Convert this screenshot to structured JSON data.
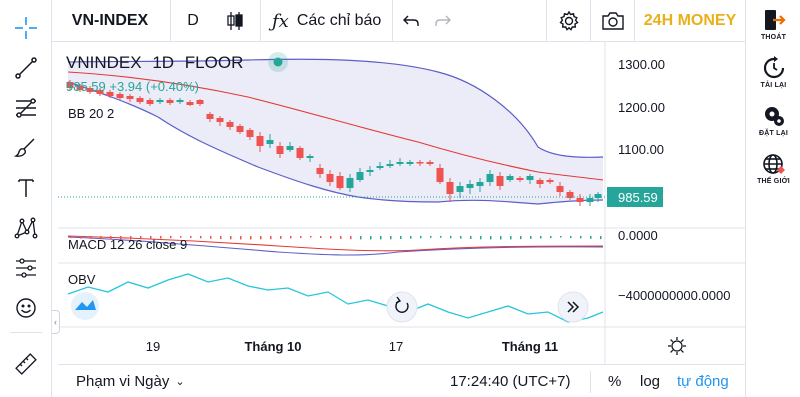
{
  "toolbar": {
    "symbol": "VN-INDEX",
    "interval": "D",
    "indicators_label": "Các chỉ báo",
    "brand": "24H MONEY"
  },
  "legend": {
    "title": "VNINDEX",
    "interval": "1D",
    "exchange": "FLOOR",
    "price_line": "985.59 +3.94 (+0.40%)",
    "bb": "BB 20 2",
    "macd": "MACD 12 26 close 9",
    "obv": "OBV"
  },
  "price_axis": {
    "ticks": [
      "1300.00",
      "1200.00",
      "1100.00"
    ],
    "last_price": "985.59",
    "macd_tick": "0.0000",
    "obv_tick": "−4000000000.0000"
  },
  "time_axis": {
    "ticks": [
      "19",
      "Tháng 10",
      "17",
      "Tháng 11"
    ]
  },
  "bottom": {
    "range_label": "Phạm vi Ngày",
    "clock": "17:24:40 (UTC+7)",
    "percent": "%",
    "log": "log",
    "auto": "tự động"
  },
  "sidebar": {
    "items": [
      {
        "label": "THOÁT",
        "icon": "logout-icon"
      },
      {
        "label": "TẢI LẠI",
        "icon": "reload-icon"
      },
      {
        "label": "ĐẶT LẠI",
        "icon": "reset-gear-icon"
      },
      {
        "label": "THẾ GIỚI",
        "icon": "globe-icon"
      }
    ]
  },
  "colors": {
    "up": "#26a69a",
    "down": "#ef5350",
    "bb_band": "#5b5fc7",
    "ma": "#e53935",
    "obv": "#26c6da",
    "brand": "#e8b01a"
  }
}
